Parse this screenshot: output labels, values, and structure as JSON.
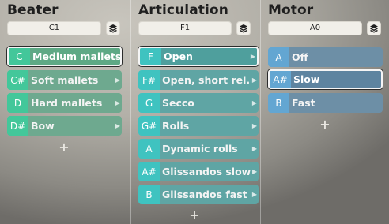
{
  "panels": [
    {
      "title": "Beater",
      "key_value": "C1",
      "layers_icon": "layers-icon",
      "items": [
        {
          "key": "C",
          "label": "Medium mallets",
          "selected": true
        },
        {
          "key": "C#",
          "label": "Soft mallets",
          "selected": false
        },
        {
          "key": "D",
          "label": "Hard mallets",
          "selected": false
        },
        {
          "key": "D#",
          "label": "Bow",
          "selected": false
        }
      ],
      "add_icon": "plus-icon"
    },
    {
      "title": "Articulation",
      "key_value": "F1",
      "layers_icon": "layers-icon",
      "items": [
        {
          "key": "F",
          "label": "Open",
          "selected": true
        },
        {
          "key": "F#",
          "label": "Open, short rel.",
          "selected": false
        },
        {
          "key": "G",
          "label": "Secco",
          "selected": false
        },
        {
          "key": "G#",
          "label": "Rolls",
          "selected": false
        },
        {
          "key": "A",
          "label": "Dynamic rolls",
          "selected": false
        },
        {
          "key": "A#",
          "label": "Glissandos slow",
          "selected": false
        },
        {
          "key": "B",
          "label": "Glissandos fast",
          "selected": false
        }
      ],
      "add_icon": "plus-icon"
    },
    {
      "title": "Motor",
      "key_value": "A0",
      "layers_icon": "layers-icon",
      "items": [
        {
          "key": "A",
          "label": "Off",
          "selected": false
        },
        {
          "key": "A#",
          "label": "Slow",
          "selected": true
        },
        {
          "key": "B",
          "label": "Fast",
          "selected": false
        }
      ],
      "add_icon": "plus-icon"
    }
  ],
  "symbols": {
    "plus": "+",
    "arrow": "▶"
  }
}
